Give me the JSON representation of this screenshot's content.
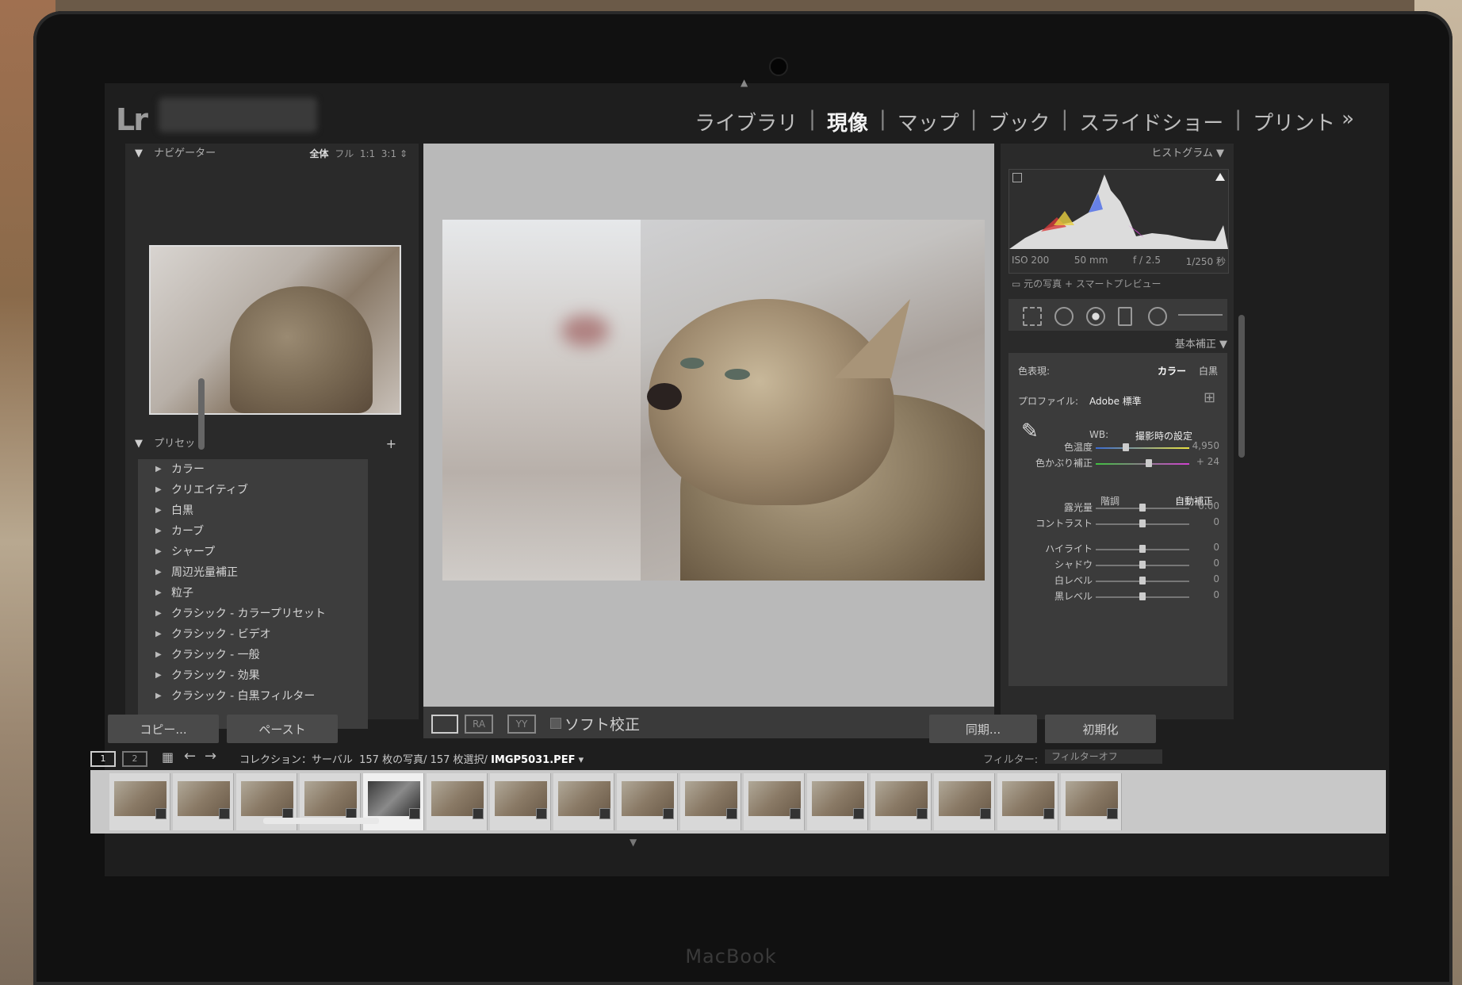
{
  "device": {
    "label": "MacBook"
  },
  "app": {
    "logo": "Lr"
  },
  "modules": [
    {
      "label": "ライブラリ",
      "active": false
    },
    {
      "label": "現像",
      "active": true
    },
    {
      "label": "マップ",
      "active": false
    },
    {
      "label": "ブック",
      "active": false
    },
    {
      "label": "スライドショー",
      "active": false
    },
    {
      "label": "プリント",
      "active": false
    }
  ],
  "modules_more": "»",
  "navigator": {
    "title": "ナビゲーター",
    "zoom": [
      "全体",
      "フル",
      "1:1",
      "3:1"
    ]
  },
  "presets": {
    "title": "プリセット",
    "add": "+",
    "items": [
      "カラー",
      "クリエイティブ",
      "白黒",
      "カーブ",
      "シャープ",
      "周辺光量補正",
      "粒子",
      "クラシック - カラープリセット",
      "クラシック - ビデオ",
      "クラシック - 一般",
      "クラシック - 効果",
      "クラシック - 白黒フィルター"
    ]
  },
  "left_buttons": {
    "copy": "コピー...",
    "paste": "ペースト"
  },
  "center_toolbar": {
    "view_ra": "RA",
    "view_yy": "YY",
    "soft_proof": "ソフト校正"
  },
  "histogram": {
    "title": "ヒストグラム",
    "iso": "ISO 200",
    "focal": "50 mm",
    "aperture": "f / 2.5",
    "shutter": "1/250 秒",
    "preview": "元の写真 + スマートプレビュー"
  },
  "basic": {
    "title": "基本補正",
    "treatment_label": "色表現:",
    "treatment_color": "カラー",
    "treatment_bw": "白黒",
    "profile_label": "プロファイル:",
    "profile_value": "Adobe 標準",
    "wb_label": "WB:",
    "wb_value": "撮影時の設定",
    "tone_label": "階調",
    "auto_label": "自動補正",
    "sliders": [
      {
        "label": "色温度",
        "value": "4,950",
        "pos": 0.32
      },
      {
        "label": "色かぶり補正",
        "value": "+ 24",
        "pos": 0.57
      },
      {
        "label": "露光量",
        "value": "0.00",
        "pos": 0.5
      },
      {
        "label": "コントラスト",
        "value": "0",
        "pos": 0.5
      },
      {
        "label": "ハイライト",
        "value": "0",
        "pos": 0.5
      },
      {
        "label": "シャドウ",
        "value": "0",
        "pos": 0.5
      },
      {
        "label": "白レベル",
        "value": "0",
        "pos": 0.5
      },
      {
        "label": "黒レベル",
        "value": "0",
        "pos": 0.5
      }
    ]
  },
  "right_buttons": {
    "sync": "同期...",
    "reset": "初期化"
  },
  "filmbar": {
    "screen1": "1",
    "screen2": "2",
    "collection": "コレクション：サーバル",
    "count": "157 枚の写真/ 157 枚選択/",
    "filename": "IMGP5031.PEF",
    "filter_label": "フィルター:",
    "filter_value": "フィルターオフ"
  }
}
